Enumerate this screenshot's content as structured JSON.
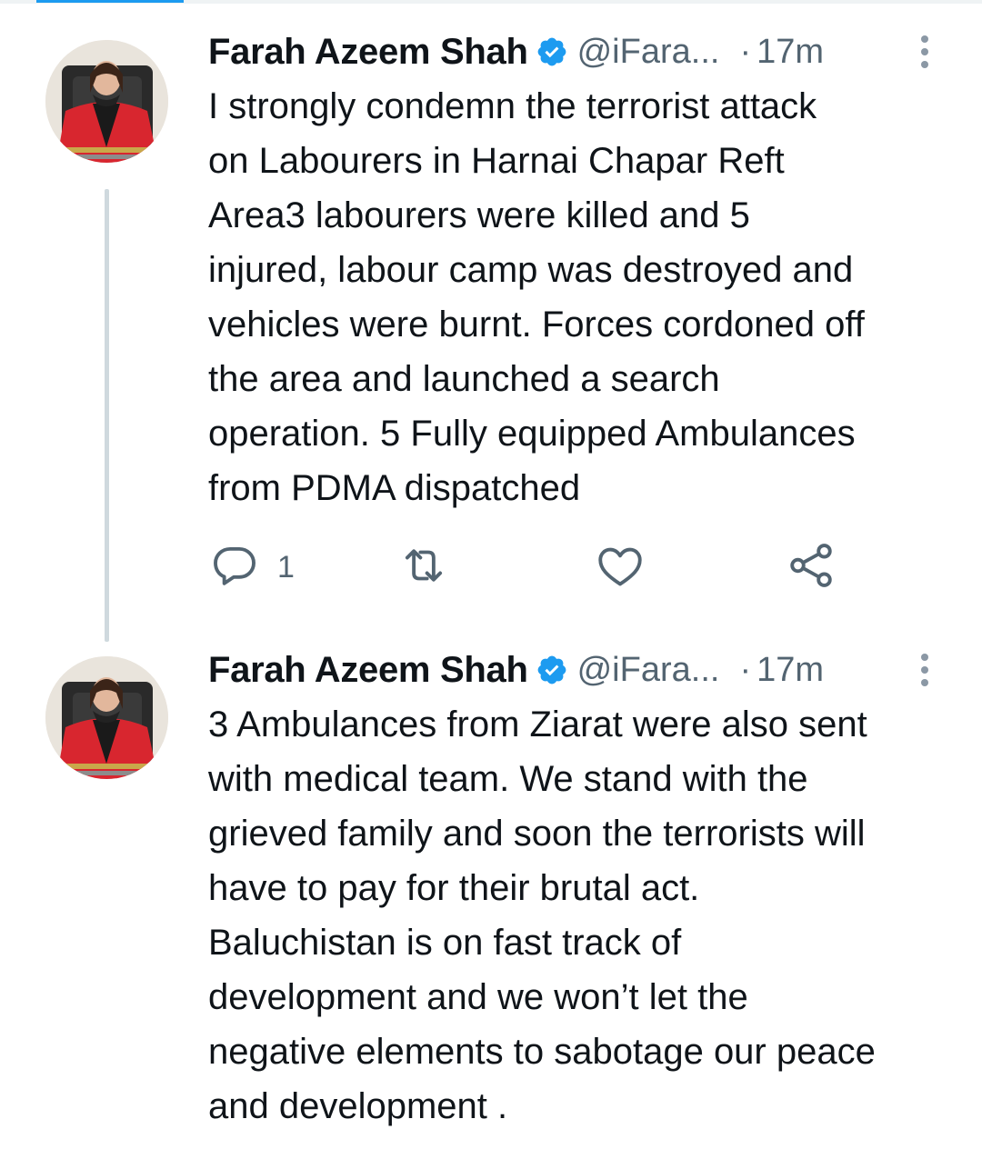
{
  "colors": {
    "accent": "#1d9bf0",
    "text_primary": "#0f1419",
    "text_secondary": "#536471",
    "thread_line": "#cfd9de"
  },
  "tweets": [
    {
      "author_name": "Farah Azeem Shah",
      "verified": true,
      "handle": "@iFara...",
      "separator": "·",
      "time": "17m",
      "text_lines": [
        "I strongly condemn the terrorist attack",
        "on Labourers in Harnai Chapar Reft",
        "Area3 labourers were killed and 5",
        "injured, labour camp was destroyed and",
        "vehicles were burnt. Forces cordoned off",
        "the area and launched a search",
        "operation. 5 Fully equipped Ambulances",
        "from PDMA dispatched"
      ],
      "reply_count": "1",
      "icons": [
        "reply-icon",
        "retweet-icon",
        "like-icon",
        "share-icon",
        "more-options-icon",
        "verified-badge-icon"
      ]
    },
    {
      "author_name": "Farah Azeem Shah",
      "verified": true,
      "handle": "@iFara...",
      "separator": "·",
      "time": "17m",
      "text_lines": [
        "3 Ambulances from Ziarat were also sent",
        "with medical team. We stand with the",
        "grieved family and soon the terrorists will",
        "have to pay for their brutal act.",
        "Baluchistan is on fast track of",
        "development and we won’t let the",
        "negative elements to sabotage our peace",
        "and development ."
      ],
      "icons": [
        "more-options-icon",
        "verified-badge-icon"
      ]
    }
  ]
}
